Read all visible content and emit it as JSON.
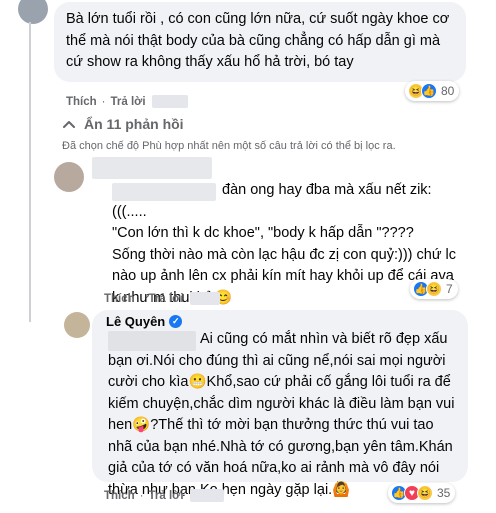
{
  "comment1": {
    "text": "Bà lớn tuổi rồi , có con cũng lớn nữa, cứ suốt ngày khoe cơ thể mà nói thật body của bà cũng chẳng có hấp dẫn gì mà cứ show ra không thấy xấu hổ hả trời, bó tay",
    "like_label": "Thích",
    "reply_label": "Trả lời",
    "reaction_icons": [
      "haha-icon",
      "like-icon"
    ],
    "reaction_count": "80"
  },
  "hide_replies": {
    "label": "Ẩn 11 phản hồi",
    "icon": "chevron-up-icon"
  },
  "filter_note": "Đã chọn chế độ Phù hợp nhất nên một số câu trả lời có thể bị lọc ra.",
  "comment2": {
    "text": "đàn ong hay đba mà xấu nết zik:(((.....\n\"Con lớn thì k dc khoe\", \"body k hấp dẫn \"????\nSống thời nào mà còn lạc hậu đc zị con quỷ:))) chứ lc nào up ảnh lên cx phải kín mít hay khỏi up để cái ava k như m thui hở😊",
    "like_label": "Thích",
    "reply_label": "Trả lời",
    "reaction_icons": [
      "like-icon",
      "haha-icon"
    ],
    "reaction_count": "7"
  },
  "comment3": {
    "author": "Lê Quyên",
    "text": "Ai cũng có mắt nhìn và biết rõ đẹp xấu bạn ơi.Nói cho đúng thì ai cũng nể,nói sai mọi người cười cho kìa😬Khổ,sao cứ phải cố gắng lôi tuổi ra để kiếm chuyện,chắc dìm người khác là điều làm bạn vui hen🤪?Thế thì tớ mời bạn thưởng thức thú vui tao nhã của bạn nhé.Nhà tớ có gương,bạn yên tâm.Khán giả của tớ có văn hoá nữa,ko ai rảnh mà vô đây nói thừa như bạn.Ko hẹn ngày gặp lại.🙆",
    "like_label": "Thích",
    "reply_label": "Trả lời",
    "reaction_icons": [
      "like-icon",
      "love-icon",
      "haha-icon"
    ],
    "reaction_count": "35"
  }
}
